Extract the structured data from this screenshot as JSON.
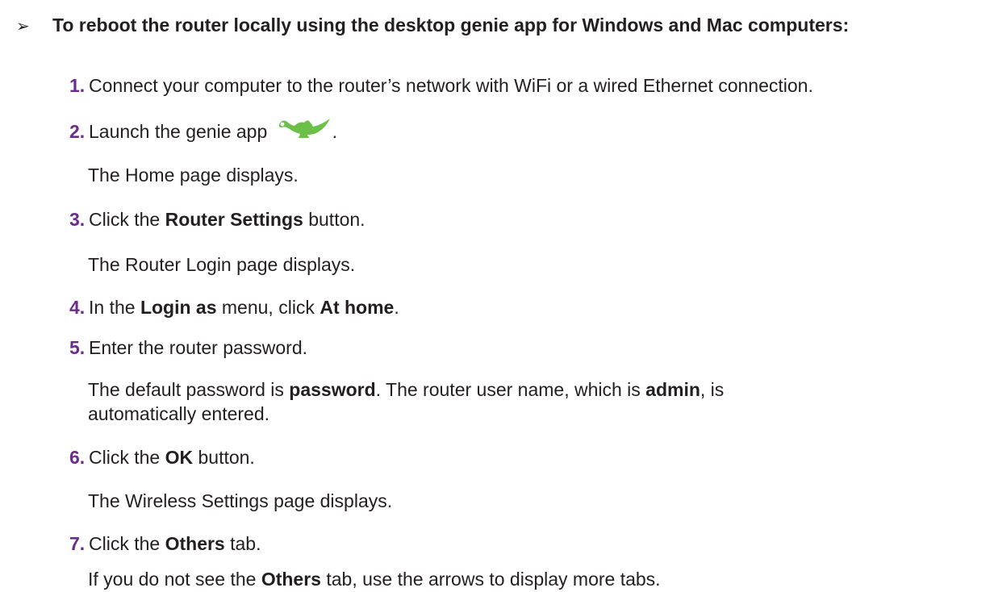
{
  "heading": {
    "marker": "➢",
    "text": "To reboot the router locally using the desktop genie app for Windows and Mac computers:"
  },
  "steps": [
    {
      "num": "1.",
      "text": "Connect your computer to the router’s network with WiFi or a wired Ethernet connection."
    },
    {
      "num": "2.",
      "pre": "Launch the genie app",
      "post": ".",
      "icon": "genie-lamp-icon",
      "icon_color": "#6cc04a"
    },
    {
      "num": "3.",
      "pre": "Click the ",
      "bold": "Router Settings",
      "post": " button."
    },
    {
      "num": "4.",
      "pre": "In the ",
      "bold1": "Login as",
      "mid": " menu, click ",
      "bold2": "At home",
      "post": "."
    },
    {
      "num": "5.",
      "text": "Enter the router password."
    },
    {
      "num": "6.",
      "pre": "Click the ",
      "bold": "OK",
      "post": " button."
    },
    {
      "num": "7.",
      "pre": "Click the ",
      "bold": "Others",
      "post": " tab."
    }
  ],
  "notes": {
    "n2": "The Home page displays.",
    "n3": "The Router Login page displays.",
    "n5": {
      "a": "The default password is ",
      "b": "password",
      "c": ". The router user name, which is ",
      "d": "admin",
      "e": ", is",
      "f": "automatically entered."
    },
    "n6": "The Wireless Settings page displays.",
    "n7": {
      "a": "If you do not see the ",
      "b": "Others",
      "c": " tab, use the arrows to display more tabs."
    }
  },
  "colors": {
    "step_number": "#6b2c8c",
    "text": "#231f20",
    "genie_icon": "#6cc04a"
  }
}
